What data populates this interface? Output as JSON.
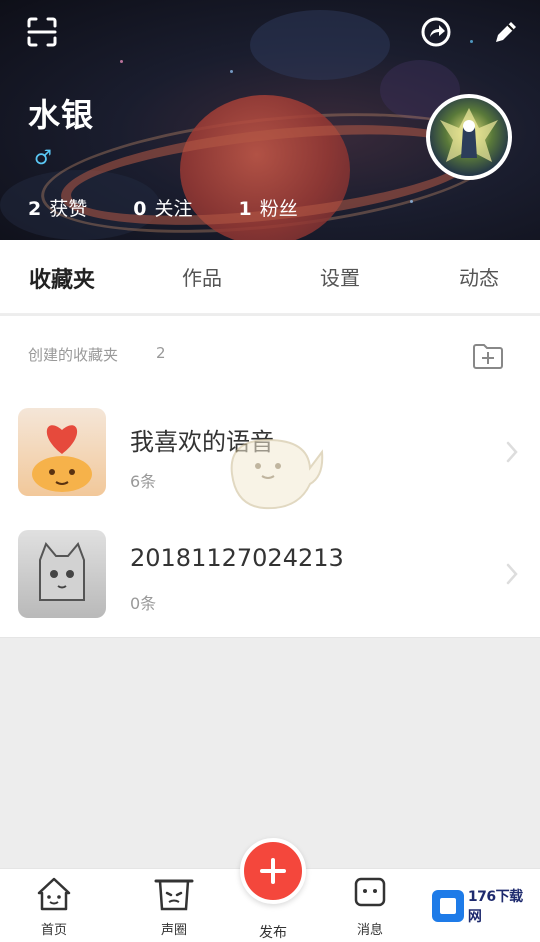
{
  "profile": {
    "name": "水银",
    "gender_symbol": "♂",
    "stats": [
      {
        "num": "2",
        "label": "获赞"
      },
      {
        "num": "0",
        "label": "关注"
      },
      {
        "num": "1",
        "label": "粉丝"
      }
    ]
  },
  "tabs": [
    "收藏夹",
    "作品",
    "设置",
    "动态"
  ],
  "active_tab": "收藏夹",
  "favorites": {
    "section_title": "创建的收藏夹",
    "count": "2",
    "items": [
      {
        "title": "我喜欢的语音",
        "subtitle": "6条"
      },
      {
        "title": "20181127024213",
        "subtitle": "0条"
      }
    ]
  },
  "bottom_nav": {
    "home": "首页",
    "circle": "声圈",
    "publish": "发布",
    "messages": "消息"
  },
  "watermark": "176下载网",
  "colors": {
    "accent": "#f4473c",
    "gender": "#5bc8f5",
    "watermark": "#1e7be8"
  }
}
